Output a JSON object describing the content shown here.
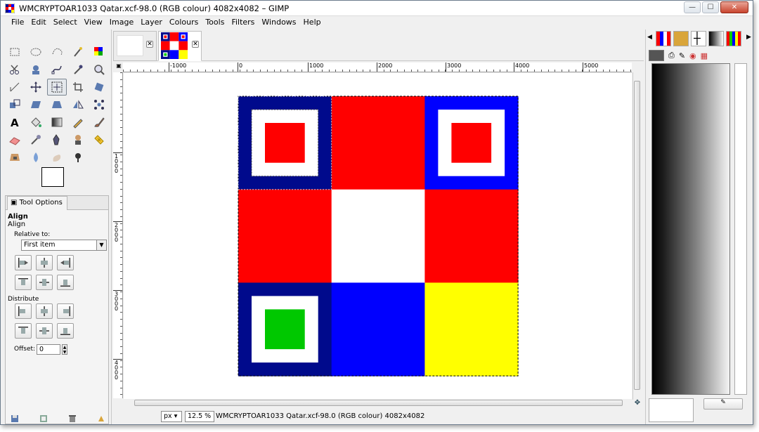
{
  "window": {
    "title": "WMCRYPTOAR1033 Qatar.xcf-98.0 (RGB colour) 4082x4082 – GIMP",
    "minimize": "—",
    "maximize": "☐",
    "close": "✕"
  },
  "menu": [
    "File",
    "Edit",
    "Select",
    "View",
    "Image",
    "Layer",
    "Colours",
    "Tools",
    "Filters",
    "Windows",
    "Help"
  ],
  "tool_options": {
    "tab_label": "Tool Options",
    "title1": "Align",
    "title2": "Align",
    "relative_to_label": "Relative to:",
    "relative_to_value": "First item",
    "distribute_label": "Distribute",
    "offset_label": "Offset:",
    "offset_value": "0"
  },
  "rulers": {
    "h_labels": [
      "-1000",
      "0",
      "1000",
      "2000",
      "3000",
      "4000",
      "5000"
    ],
    "v_labels": [
      "1000",
      "2000",
      "3000",
      "4000"
    ]
  },
  "statusbar": {
    "unit": "px",
    "zoom": "12.5 %",
    "info": "WMCRYPTOAR1033 Qatar.xcf-98.0 (RGB colour) 4082x4082"
  },
  "colors": {
    "navy": "#000a8c",
    "blue": "#0000ff",
    "red": "#ff0000",
    "white": "#ffffff",
    "yellow": "#ffff00",
    "green": "#00c800"
  },
  "canvas_cells": [
    {
      "name": "cell-top-left",
      "bg": "navy",
      "inner": "red"
    },
    {
      "name": "cell-top-center",
      "bg": "red",
      "inner": ""
    },
    {
      "name": "cell-top-right",
      "bg": "blue",
      "inner": "red"
    },
    {
      "name": "cell-middle-left",
      "bg": "red",
      "inner": ""
    },
    {
      "name": "cell-middle-center",
      "bg": "white",
      "inner": ""
    },
    {
      "name": "cell-middle-right",
      "bg": "red",
      "inner": ""
    },
    {
      "name": "cell-bottom-left",
      "bg": "navy",
      "inner": "green"
    },
    {
      "name": "cell-bottom-center",
      "bg": "blue",
      "inner": ""
    },
    {
      "name": "cell-bottom-right",
      "bg": "yellow",
      "inner": ""
    }
  ],
  "tools": [
    "rect-select",
    "ellipse-select",
    "free-select",
    "fuzzy-select",
    "select-by-color",
    "scissors-select",
    "foreground-select",
    "paths",
    "color-picker",
    "zoom",
    "measure",
    "move",
    "align",
    "crop",
    "rotate",
    "scale",
    "shear",
    "perspective",
    "flip",
    "cage-transform",
    "text",
    "bucket-fill",
    "blend",
    "pencil",
    "paintbrush",
    "eraser",
    "airbrush",
    "ink",
    "clone",
    "heal",
    "perspective-clone",
    "blur",
    "smudge",
    "dodge-burn"
  ]
}
